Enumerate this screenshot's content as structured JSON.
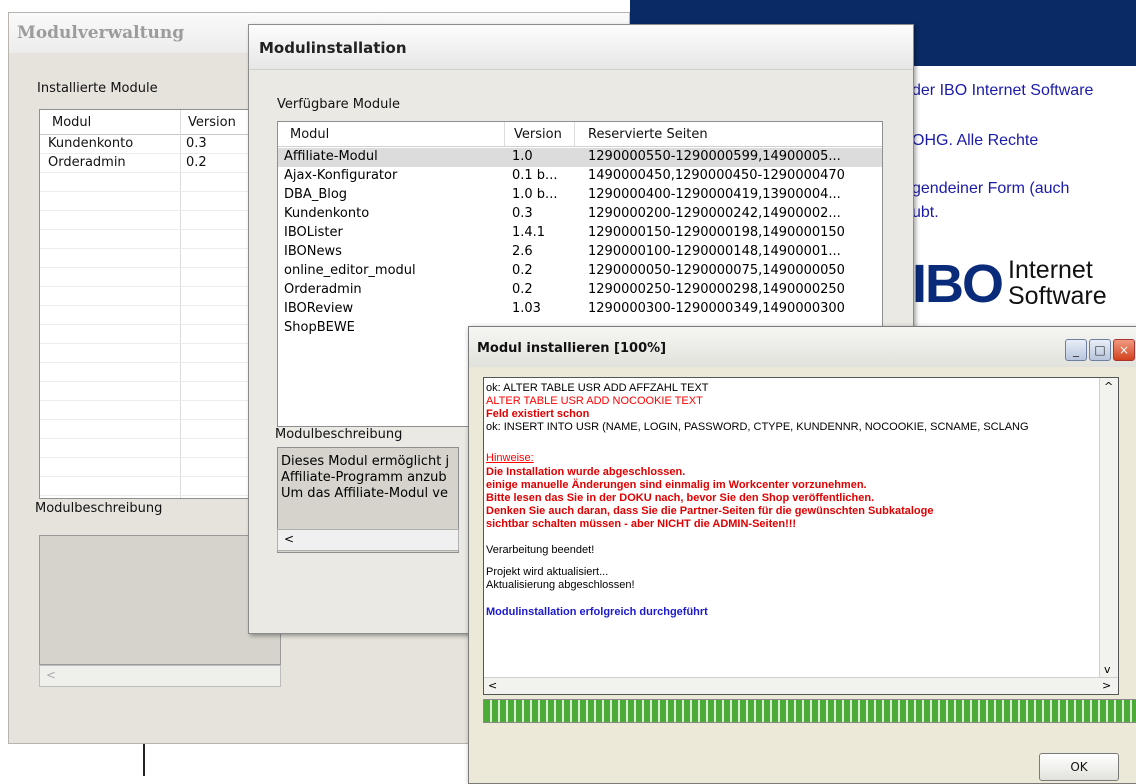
{
  "background": {
    "text_lines": [
      "der IBO Internet Software",
      "OHG. Alle Rechte",
      "gendeiner Form (auch",
      "ubt."
    ],
    "logo_ibo": "IBO",
    "logo_internet": "Internet",
    "logo_software": "Software"
  },
  "modulverwaltung": {
    "title": "Modulverwaltung",
    "installed_label": "Installierte Module",
    "columns": [
      "Modul",
      "Version"
    ],
    "rows": [
      {
        "modul": "Kundenkonto",
        "version": "0.3"
      },
      {
        "modul": "Orderadmin",
        "version": "0.2"
      }
    ],
    "desc_label": "Modulbeschreibung"
  },
  "modulinstallation": {
    "title": "Modulinstallation",
    "available_label": "Verfügbare Module",
    "columns": [
      "Modul",
      "Version",
      "Reservierte Seiten"
    ],
    "rows": [
      {
        "modul": "Affiliate-Modul",
        "version": "1.0",
        "seiten": "1290000550-1290000599,14900005..."
      },
      {
        "modul": "Ajax-Konfigurator",
        "version": "0.1 b...",
        "seiten": "1490000450,1290000450-1290000470"
      },
      {
        "modul": "DBA_Blog",
        "version": "1.0 b...",
        "seiten": "1290000400-1290000419,13900004..."
      },
      {
        "modul": "Kundenkonto",
        "version": "0.3",
        "seiten": "1290000200-1290000242,14900002..."
      },
      {
        "modul": "IBOLister",
        "version": "1.4.1",
        "seiten": "1290000150-1290000198,1490000150"
      },
      {
        "modul": "IBONews",
        "version": "2.6",
        "seiten": "1290000100-1290000148,14900001..."
      },
      {
        "modul": "online_editor_modul",
        "version": "0.2",
        "seiten": "1290000050-1290000075,1490000050"
      },
      {
        "modul": "Orderadmin",
        "version": "0.2",
        "seiten": "1290000250-1290000298,1490000250"
      },
      {
        "modul": "IBOReview",
        "version": "1.03",
        "seiten": "1290000300-1290000349,1490000300"
      },
      {
        "modul": "ShopBEWE",
        "version": "",
        "seiten": ""
      }
    ],
    "desc_label": "Modulbeschreibung",
    "desc_lines": [
      "Dieses Modul ermöglicht j",
      "Affiliate-Programm anzub",
      "Um das Affiliate-Modul ve"
    ]
  },
  "installer": {
    "title": "Modul installieren [100%]",
    "log": [
      {
        "text": "ok: ALTER TABLE USR ADD AFFZAHL TEXT",
        "style": "normal"
      },
      {
        "text": "ALTER TABLE USR ADD NOCOOKIE TEXT",
        "style": "red"
      },
      {
        "text": "Feld existiert schon",
        "style": "redb"
      },
      {
        "text": "ok: INSERT INTO USR (NAME, LOGIN, PASSWORD, CTYPE, KUNDENNR, NOCOOKIE, SCNAME, SCLANG",
        "style": "normal"
      },
      {
        "text": "",
        "style": "normal"
      },
      {
        "text": "Hinweise:",
        "style": "redu"
      },
      {
        "text": "Die Installation wurde abgeschlossen.",
        "style": "redb"
      },
      {
        "text": "einige manuelle Änderungen sind einmalig im Workcenter vorzunehmen.",
        "style": "redb"
      },
      {
        "text": "Bitte lesen das Sie in der DOKU nach, bevor Sie den Shop veröffentlichen.",
        "style": "redb"
      },
      {
        "text": "Denken Sie auch daran, dass Sie die Partner-Seiten für die gewünschten Subkataloge",
        "style": "redb"
      },
      {
        "text": "sichtbar schalten müssen - aber NICHT die ADMIN-Seiten!!!",
        "style": "redb"
      },
      {
        "text": "Verarbeitung beendet!",
        "style": "normal"
      },
      {
        "text": "Projekt wird aktualisiert...",
        "style": "normal"
      },
      {
        "text": "Aktualisierung abgeschlossen!",
        "style": "normal"
      },
      {
        "text": "Modulinstallation erfolgreich durchgeführt",
        "style": "blueb"
      }
    ],
    "progress_percent": 100,
    "ok_label": "OK"
  }
}
